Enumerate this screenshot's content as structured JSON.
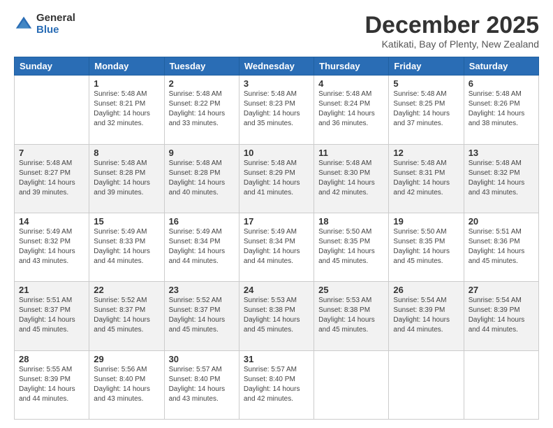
{
  "logo": {
    "general": "General",
    "blue": "Blue"
  },
  "header": {
    "month_title": "December 2025",
    "subtitle": "Katikati, Bay of Plenty, New Zealand"
  },
  "days_of_week": [
    "Sunday",
    "Monday",
    "Tuesday",
    "Wednesday",
    "Thursday",
    "Friday",
    "Saturday"
  ],
  "weeks": [
    [
      {
        "day": "",
        "sunrise": "",
        "sunset": "",
        "daylight": ""
      },
      {
        "day": "1",
        "sunrise": "Sunrise: 5:48 AM",
        "sunset": "Sunset: 8:21 PM",
        "daylight": "Daylight: 14 hours and 32 minutes."
      },
      {
        "day": "2",
        "sunrise": "Sunrise: 5:48 AM",
        "sunset": "Sunset: 8:22 PM",
        "daylight": "Daylight: 14 hours and 33 minutes."
      },
      {
        "day": "3",
        "sunrise": "Sunrise: 5:48 AM",
        "sunset": "Sunset: 8:23 PM",
        "daylight": "Daylight: 14 hours and 35 minutes."
      },
      {
        "day": "4",
        "sunrise": "Sunrise: 5:48 AM",
        "sunset": "Sunset: 8:24 PM",
        "daylight": "Daylight: 14 hours and 36 minutes."
      },
      {
        "day": "5",
        "sunrise": "Sunrise: 5:48 AM",
        "sunset": "Sunset: 8:25 PM",
        "daylight": "Daylight: 14 hours and 37 minutes."
      },
      {
        "day": "6",
        "sunrise": "Sunrise: 5:48 AM",
        "sunset": "Sunset: 8:26 PM",
        "daylight": "Daylight: 14 hours and 38 minutes."
      }
    ],
    [
      {
        "day": "7",
        "sunrise": "Sunrise: 5:48 AM",
        "sunset": "Sunset: 8:27 PM",
        "daylight": "Daylight: 14 hours and 39 minutes."
      },
      {
        "day": "8",
        "sunrise": "Sunrise: 5:48 AM",
        "sunset": "Sunset: 8:28 PM",
        "daylight": "Daylight: 14 hours and 39 minutes."
      },
      {
        "day": "9",
        "sunrise": "Sunrise: 5:48 AM",
        "sunset": "Sunset: 8:28 PM",
        "daylight": "Daylight: 14 hours and 40 minutes."
      },
      {
        "day": "10",
        "sunrise": "Sunrise: 5:48 AM",
        "sunset": "Sunset: 8:29 PM",
        "daylight": "Daylight: 14 hours and 41 minutes."
      },
      {
        "day": "11",
        "sunrise": "Sunrise: 5:48 AM",
        "sunset": "Sunset: 8:30 PM",
        "daylight": "Daylight: 14 hours and 42 minutes."
      },
      {
        "day": "12",
        "sunrise": "Sunrise: 5:48 AM",
        "sunset": "Sunset: 8:31 PM",
        "daylight": "Daylight: 14 hours and 42 minutes."
      },
      {
        "day": "13",
        "sunrise": "Sunrise: 5:48 AM",
        "sunset": "Sunset: 8:32 PM",
        "daylight": "Daylight: 14 hours and 43 minutes."
      }
    ],
    [
      {
        "day": "14",
        "sunrise": "Sunrise: 5:49 AM",
        "sunset": "Sunset: 8:32 PM",
        "daylight": "Daylight: 14 hours and 43 minutes."
      },
      {
        "day": "15",
        "sunrise": "Sunrise: 5:49 AM",
        "sunset": "Sunset: 8:33 PM",
        "daylight": "Daylight: 14 hours and 44 minutes."
      },
      {
        "day": "16",
        "sunrise": "Sunrise: 5:49 AM",
        "sunset": "Sunset: 8:34 PM",
        "daylight": "Daylight: 14 hours and 44 minutes."
      },
      {
        "day": "17",
        "sunrise": "Sunrise: 5:49 AM",
        "sunset": "Sunset: 8:34 PM",
        "daylight": "Daylight: 14 hours and 44 minutes."
      },
      {
        "day": "18",
        "sunrise": "Sunrise: 5:50 AM",
        "sunset": "Sunset: 8:35 PM",
        "daylight": "Daylight: 14 hours and 45 minutes."
      },
      {
        "day": "19",
        "sunrise": "Sunrise: 5:50 AM",
        "sunset": "Sunset: 8:35 PM",
        "daylight": "Daylight: 14 hours and 45 minutes."
      },
      {
        "day": "20",
        "sunrise": "Sunrise: 5:51 AM",
        "sunset": "Sunset: 8:36 PM",
        "daylight": "Daylight: 14 hours and 45 minutes."
      }
    ],
    [
      {
        "day": "21",
        "sunrise": "Sunrise: 5:51 AM",
        "sunset": "Sunset: 8:37 PM",
        "daylight": "Daylight: 14 hours and 45 minutes."
      },
      {
        "day": "22",
        "sunrise": "Sunrise: 5:52 AM",
        "sunset": "Sunset: 8:37 PM",
        "daylight": "Daylight: 14 hours and 45 minutes."
      },
      {
        "day": "23",
        "sunrise": "Sunrise: 5:52 AM",
        "sunset": "Sunset: 8:37 PM",
        "daylight": "Daylight: 14 hours and 45 minutes."
      },
      {
        "day": "24",
        "sunrise": "Sunrise: 5:53 AM",
        "sunset": "Sunset: 8:38 PM",
        "daylight": "Daylight: 14 hours and 45 minutes."
      },
      {
        "day": "25",
        "sunrise": "Sunrise: 5:53 AM",
        "sunset": "Sunset: 8:38 PM",
        "daylight": "Daylight: 14 hours and 45 minutes."
      },
      {
        "day": "26",
        "sunrise": "Sunrise: 5:54 AM",
        "sunset": "Sunset: 8:39 PM",
        "daylight": "Daylight: 14 hours and 44 minutes."
      },
      {
        "day": "27",
        "sunrise": "Sunrise: 5:54 AM",
        "sunset": "Sunset: 8:39 PM",
        "daylight": "Daylight: 14 hours and 44 minutes."
      }
    ],
    [
      {
        "day": "28",
        "sunrise": "Sunrise: 5:55 AM",
        "sunset": "Sunset: 8:39 PM",
        "daylight": "Daylight: 14 hours and 44 minutes."
      },
      {
        "day": "29",
        "sunrise": "Sunrise: 5:56 AM",
        "sunset": "Sunset: 8:40 PM",
        "daylight": "Daylight: 14 hours and 43 minutes."
      },
      {
        "day": "30",
        "sunrise": "Sunrise: 5:57 AM",
        "sunset": "Sunset: 8:40 PM",
        "daylight": "Daylight: 14 hours and 43 minutes."
      },
      {
        "day": "31",
        "sunrise": "Sunrise: 5:57 AM",
        "sunset": "Sunset: 8:40 PM",
        "daylight": "Daylight: 14 hours and 42 minutes."
      },
      {
        "day": "",
        "sunrise": "",
        "sunset": "",
        "daylight": ""
      },
      {
        "day": "",
        "sunrise": "",
        "sunset": "",
        "daylight": ""
      },
      {
        "day": "",
        "sunrise": "",
        "sunset": "",
        "daylight": ""
      }
    ]
  ]
}
